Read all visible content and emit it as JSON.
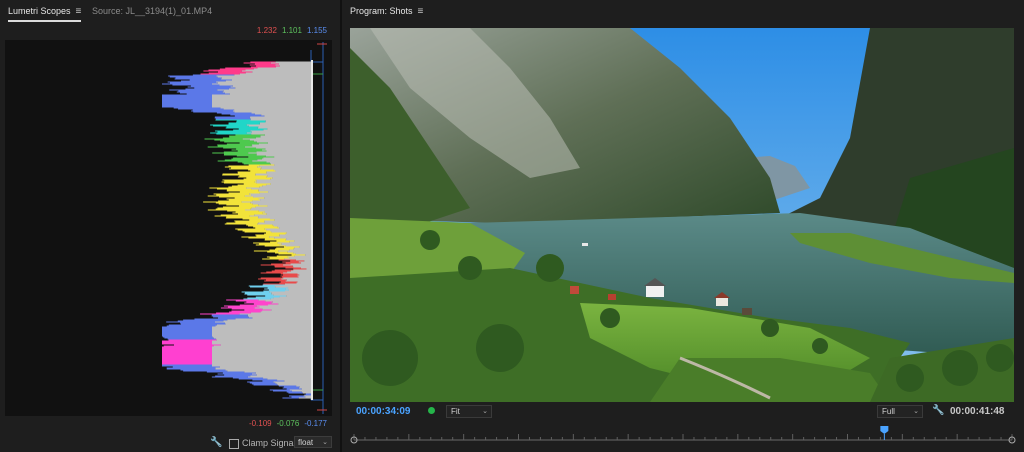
{
  "left_panel": {
    "active_tab": "Lumetri Scopes",
    "inactive_tab": "Source: JL__3194(1)_01.MP4",
    "menu_icon": "hamburger-menu-icon",
    "top_values": {
      "r": "1.232",
      "g": "1.101",
      "b": "1.155"
    },
    "bottom_values": {
      "r": "-0.109",
      "g": "-0.076",
      "b": "-0.177"
    },
    "controls": {
      "clamp_label": "Clamp Signal",
      "clamp_checked": false,
      "bit_depth": "float",
      "wrench_icon": "wrench-icon"
    }
  },
  "right_panel": {
    "title": "Program: Shots",
    "menu_icon": "hamburger-menu-icon",
    "current_timecode": "00:00:34:09",
    "duration_timecode": "00:00:41:48",
    "zoom": "Fit",
    "resolution": "Full",
    "playhead_fraction": 0.806,
    "accent_color": "#4aa3ff"
  }
}
